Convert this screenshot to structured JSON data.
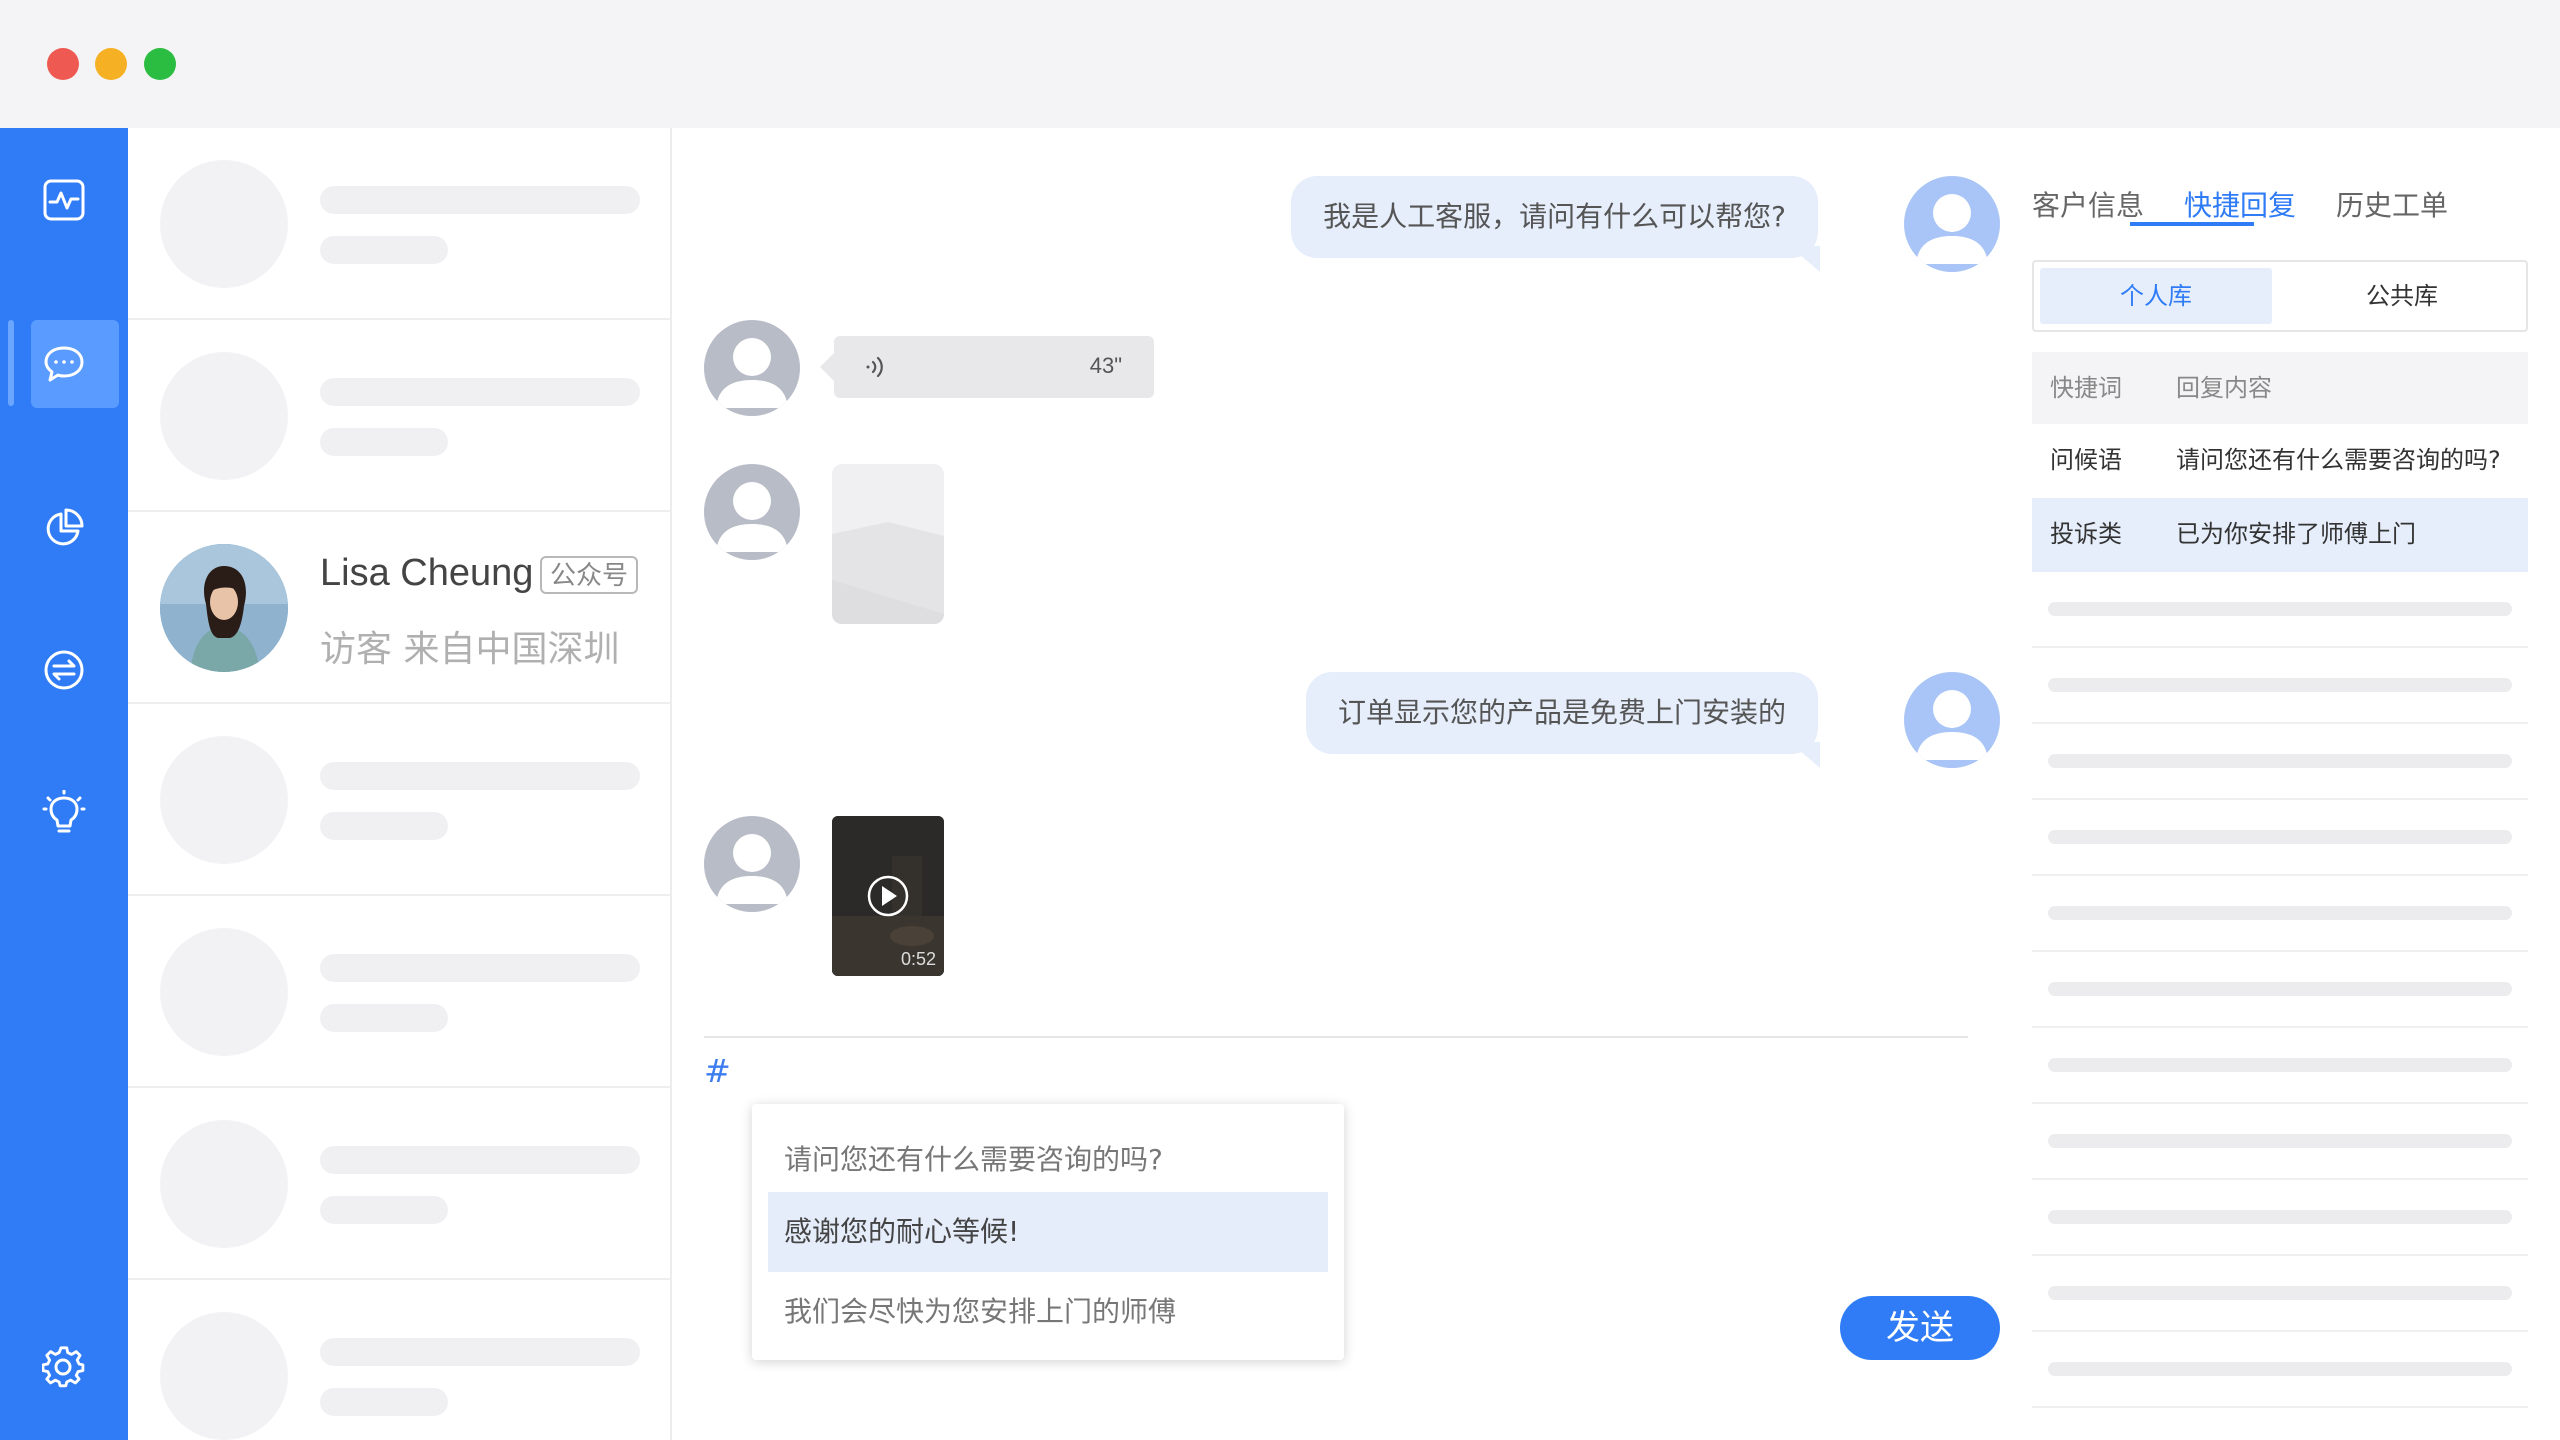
{
  "window": {
    "controls": [
      "close",
      "minimize",
      "maximize"
    ],
    "colors": {
      "close": "#ee5a52",
      "minimize": "#f6b023",
      "maximize": "#2bbd42"
    }
  },
  "sidebar": {
    "accent": "#2f7cf6",
    "items": [
      {
        "icon": "activity-icon",
        "active": false
      },
      {
        "icon": "chat-bubble-icon",
        "active": true
      },
      {
        "icon": "pie-chart-icon",
        "active": false
      },
      {
        "icon": "transfer-icon",
        "active": false
      },
      {
        "icon": "lightbulb-icon",
        "active": false
      },
      {
        "icon": "gear-icon",
        "active": false
      }
    ]
  },
  "conversations": {
    "active": {
      "name": "Lisa Cheung",
      "badge": "公众号",
      "subtitle": "访客 来自中国深圳"
    }
  },
  "chat": {
    "messages": [
      {
        "side": "right",
        "type": "text",
        "text": "我是人工客服，请问有什么可以帮您?"
      },
      {
        "side": "left",
        "type": "voice",
        "duration": "43\""
      },
      {
        "side": "left",
        "type": "image"
      },
      {
        "side": "right",
        "type": "text",
        "text": "订单显示您的产品是免费上门安装的"
      },
      {
        "side": "left",
        "type": "video",
        "duration": "0:52"
      }
    ],
    "input": {
      "value": "#"
    },
    "suggestions": [
      {
        "text": "请问您还有什么需要咨询的吗?",
        "active": false
      },
      {
        "text": "感谢您的耐心等候!",
        "active": true
      },
      {
        "text": "我们会尽快为您安排上门的师傅",
        "active": false
      }
    ],
    "send_label": "发送"
  },
  "right_panel": {
    "tabs": [
      {
        "label": "客户信息",
        "active": false
      },
      {
        "label": "快捷回复",
        "active": true
      },
      {
        "label": "历史工单",
        "active": false
      }
    ],
    "library_toggle": [
      {
        "label": "个人库",
        "active": true
      },
      {
        "label": "公共库",
        "active": false
      }
    ],
    "table": {
      "headers": [
        "快捷词",
        "回复内容"
      ],
      "rows": [
        {
          "keyword": "问候语",
          "content": "请问您还有什么需要咨询的吗?",
          "highlighted": false
        },
        {
          "keyword": "投诉类",
          "content": "已为你安排了师傅上门",
          "highlighted": true
        }
      ]
    }
  }
}
